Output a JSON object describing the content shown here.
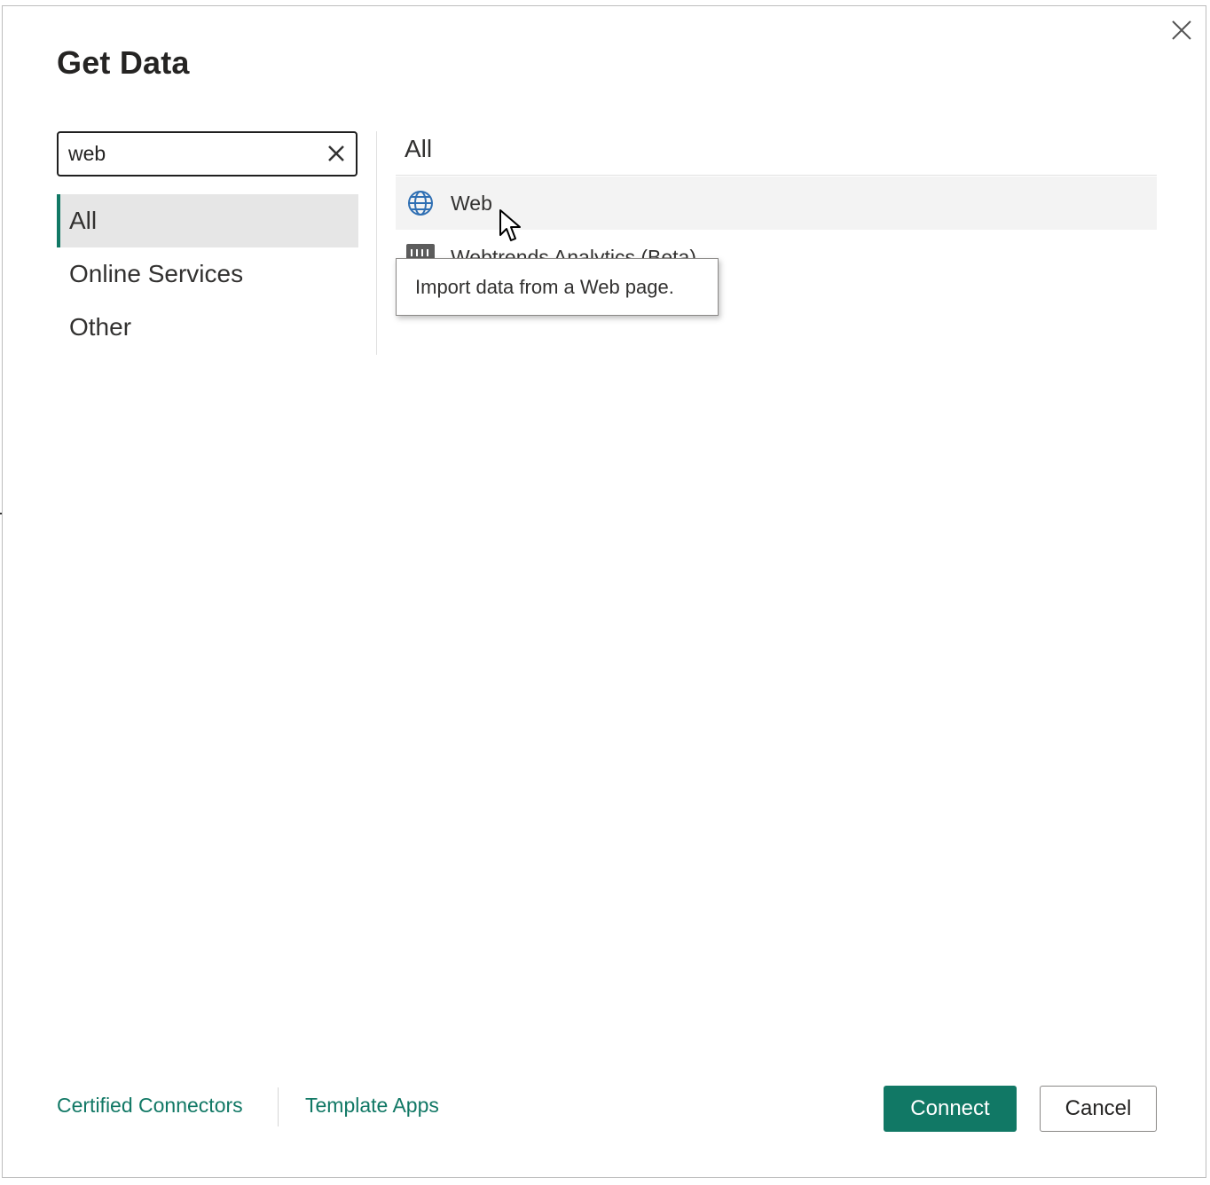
{
  "dialog": {
    "title": "Get Data",
    "close_icon": "close-icon"
  },
  "search": {
    "value": "web",
    "clear_icon": "clear-x-icon"
  },
  "categories": [
    {
      "label": "All",
      "active": true
    },
    {
      "label": "Online Services",
      "active": false
    },
    {
      "label": "Other",
      "active": false
    }
  ],
  "results": {
    "section_title": "All",
    "items": [
      {
        "label": "Web",
        "icon": "globe-icon",
        "selected": true
      },
      {
        "label": "Webtrends Analytics (Beta)",
        "icon": "webtrends-icon",
        "selected": false
      }
    ],
    "tooltip": "Import data from a Web page."
  },
  "footer": {
    "certified_connectors": "Certified Connectors",
    "template_apps": "Template Apps",
    "connect_label": "Connect",
    "cancel_label": "Cancel"
  },
  "colors": {
    "accent": "#117865",
    "selected_bg": "#f3f3f3",
    "active_category_bg": "#e6e6e6"
  }
}
